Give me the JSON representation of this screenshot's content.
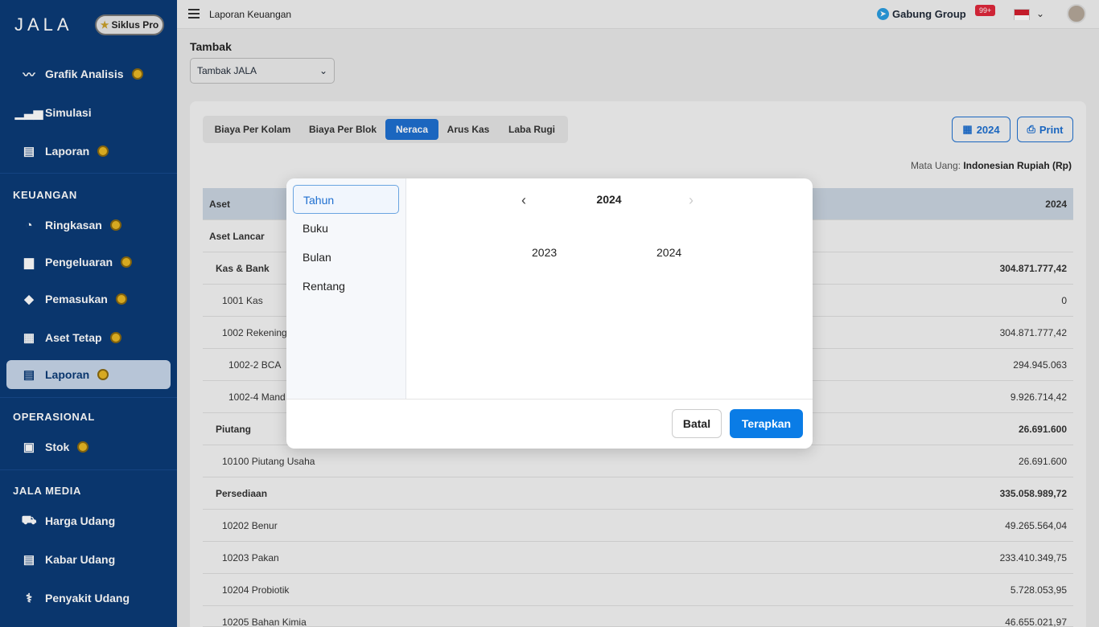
{
  "brand": {
    "logo": "JALA",
    "badge": "Siklus Pro"
  },
  "sidebar": {
    "top_items": [
      {
        "label": "Grafik Analisis",
        "icon": "chart-line-icon"
      },
      {
        "label": "Simulasi",
        "icon": "chart-bar-icon"
      },
      {
        "label": "Laporan",
        "icon": "document-icon"
      }
    ],
    "sections": [
      {
        "title": "KEUANGAN"
      },
      {
        "title": "OPERASIONAL"
      },
      {
        "title": "JALA MEDIA"
      }
    ],
    "keuangan_items": [
      {
        "label": "Ringkasan",
        "icon": "pie-icon"
      },
      {
        "label": "Pengeluaran",
        "icon": "bag-icon"
      },
      {
        "label": "Pemasukan",
        "icon": "tag-icon"
      },
      {
        "label": "Aset Tetap",
        "icon": "building-icon"
      },
      {
        "label": "Laporan",
        "icon": "report-icon",
        "active": true
      }
    ],
    "operasional_items": [
      {
        "label": "Stok",
        "icon": "boxes-icon"
      }
    ],
    "media_items": [
      {
        "label": "Harga Udang",
        "icon": "truck-icon"
      },
      {
        "label": "Kabar Udang",
        "icon": "news-icon"
      },
      {
        "label": "Penyakit Udang",
        "icon": "stethoscope-icon"
      }
    ]
  },
  "header": {
    "title": "Laporan Keuangan",
    "group": "Gabung Group",
    "notif": "99+"
  },
  "filter": {
    "label": "Tambak",
    "value": "Tambak JALA"
  },
  "tabs": [
    {
      "label": "Biaya Per Kolam"
    },
    {
      "label": "Biaya Per Blok"
    },
    {
      "label": "Neraca",
      "active": true
    },
    {
      "label": "Arus Kas"
    },
    {
      "label": "Laba Rugi"
    }
  ],
  "actions": {
    "year": "2024",
    "print": "Print"
  },
  "currency": {
    "label": "Mata Uang:",
    "value": "Indonesian Rupiah (Rp)"
  },
  "table": {
    "header": {
      "label": "Aset",
      "year": "2024"
    },
    "rows": [
      {
        "label": "Aset Lancar",
        "value": ""
      },
      {
        "label": "Kas & Bank",
        "value": "304.871.777,42"
      },
      {
        "label": "1001 Kas",
        "value": "0"
      },
      {
        "label": "1002 Rekening",
        "value": "304.871.777,42"
      },
      {
        "label": "1002-2 BCA",
        "value": "294.945.063"
      },
      {
        "label": "1002-4 Mand",
        "value": "9.926.714,42"
      },
      {
        "label": "Piutang",
        "value": "26.691.600"
      },
      {
        "label": "10100 Piutang Usaha",
        "value": "26.691.600"
      },
      {
        "label": "Persediaan",
        "value": "335.058.989,72"
      },
      {
        "label": "10202 Benur",
        "value": "49.265.564,04"
      },
      {
        "label": "10203 Pakan",
        "value": "233.410.349,75"
      },
      {
        "label": "10204 Probiotik",
        "value": "5.728.053,95"
      },
      {
        "label": "10205 Bahan Kimia",
        "value": "46.655.021,97"
      }
    ]
  },
  "modal": {
    "options": [
      {
        "label": "Tahun",
        "active": true
      },
      {
        "label": "Buku"
      },
      {
        "label": "Bulan"
      },
      {
        "label": "Rentang"
      }
    ],
    "current_year": "2024",
    "years": [
      "2023",
      "2024"
    ],
    "cancel": "Batal",
    "apply": "Terapkan"
  }
}
